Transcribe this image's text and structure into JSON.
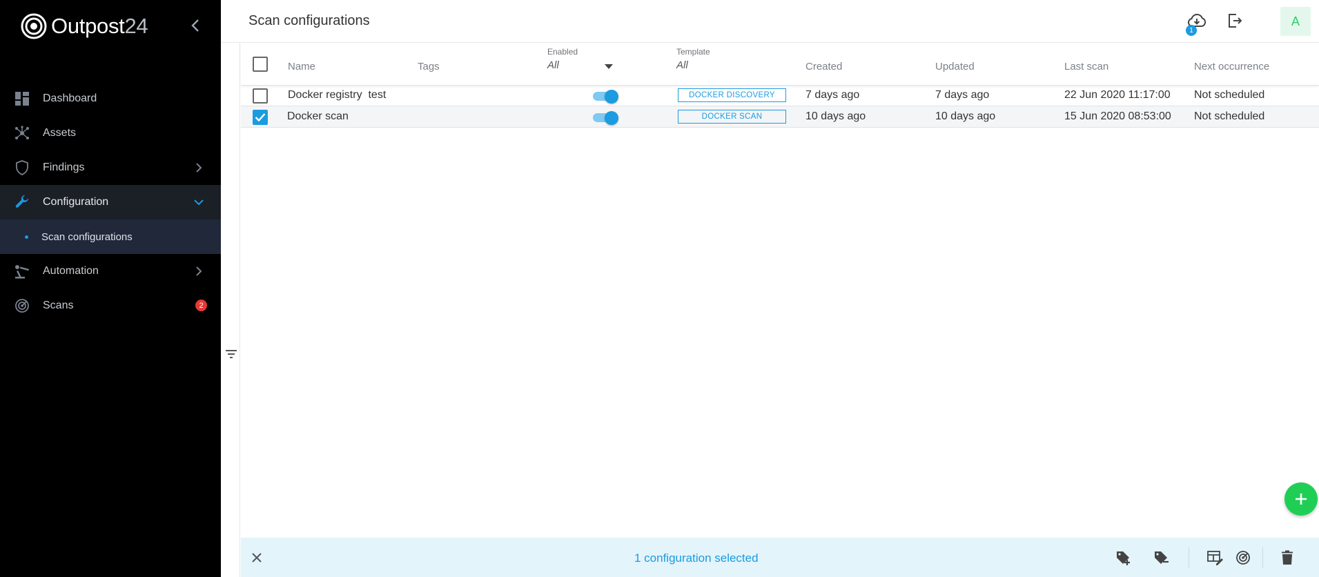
{
  "brand": {
    "name": "Outpost",
    "number": "24"
  },
  "header": {
    "title": "Scan configurations",
    "download_badge": "1",
    "avatar_initial": "A"
  },
  "sidebar": {
    "items": [
      {
        "label": "Dashboard",
        "icon": "dashboard-icon"
      },
      {
        "label": "Assets",
        "icon": "network-icon"
      },
      {
        "label": "Findings",
        "icon": "shield-icon"
      },
      {
        "label": "Configuration",
        "icon": "wrench-icon"
      },
      {
        "label": "Automation",
        "icon": "automation-icon"
      },
      {
        "label": "Scans",
        "icon": "radar-icon",
        "badge": "2"
      }
    ],
    "sub_items": [
      {
        "label": "Scan configurations"
      }
    ]
  },
  "table": {
    "columns": {
      "name": "Name",
      "tags": "Tags",
      "enabled": "Enabled",
      "enabled_filter": "All",
      "template": "Template",
      "template_filter": "All",
      "created": "Created",
      "updated": "Updated",
      "last_scan": "Last scan",
      "next_occurrence": "Next occurrence"
    },
    "rows": [
      {
        "name": "Docker registry  test",
        "tags": "",
        "enabled": true,
        "template": "DOCKER DISCOVERY",
        "created": "7 days ago",
        "updated": "7 days ago",
        "last_scan": "22 Jun 2020 11:17:00",
        "next_occurrence": "Not scheduled",
        "selected": false
      },
      {
        "name": "Docker scan",
        "tags": "",
        "enabled": true,
        "template": "DOCKER SCAN",
        "created": "10 days ago",
        "updated": "10 days ago",
        "last_scan": "15 Jun 2020 08:53:00",
        "next_occurrence": "Not scheduled",
        "selected": true
      }
    ]
  },
  "selection_bar": {
    "text": "1 configuration selected"
  },
  "colors": {
    "accent": "#1b9be0",
    "fab": "#1fcf55",
    "sidebar_bg": "#000000",
    "badge": "#e53935"
  }
}
